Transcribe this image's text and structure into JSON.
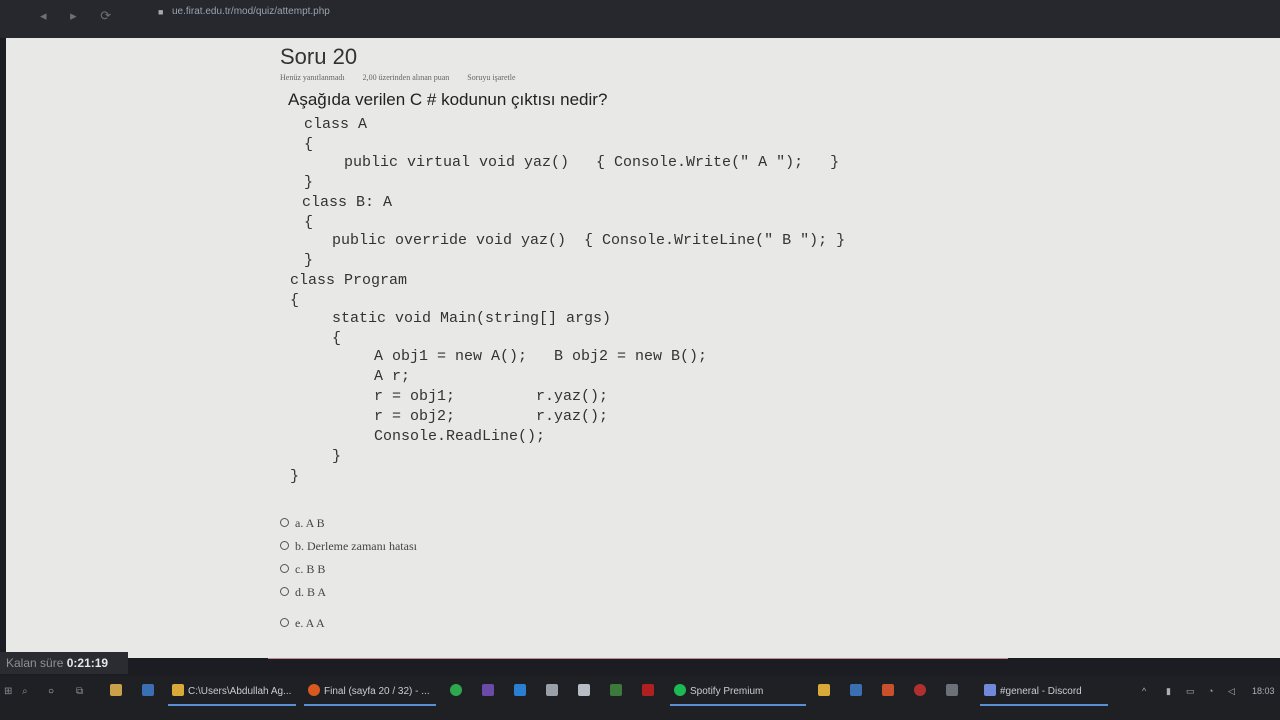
{
  "browser": {
    "url": "ue.firat.edu.tr/mod/quiz/attempt.php"
  },
  "question": {
    "title": "Soru 20",
    "meta": [
      "Henüz yanıtlanmadı",
      "2,00 üzerinden alınan puan",
      "Soruyu işaretle"
    ],
    "text": "Aşağıda verilen C # kodunun çıktısı nedir?",
    "code_lines": [
      "class A",
      "{",
      "public virtual void yaz()   { Console.Write(\" A \");   }",
      "}",
      "class B: A",
      "{",
      "public override void yaz()  { Console.WriteLine(\" B \"); }",
      "}",
      "class Program",
      "{",
      "static void Main(string[] args)",
      "{",
      "A obj1 = new A();   B obj2 = new B();",
      "A r;",
      "r = obj1;         r.yaz();",
      "r = obj2;         r.yaz();",
      "Console.ReadLine();",
      "}",
      "}"
    ],
    "options": [
      "a. A B",
      "b. Derleme zamanı hatası",
      "c. B B",
      "d. B A",
      "e. A A"
    ]
  },
  "timer": {
    "label": "Kalan süre",
    "value": "0:21:19"
  },
  "taskbar": {
    "items": [
      "C:\\Users\\Abdullah  Ag...",
      "Final (sayfa 20 / 32) - ...",
      "Spotify Premium",
      "#general - Discord"
    ],
    "clock": "18:03"
  },
  "colors": {
    "page_bg": "#e8e8e6",
    "taskbar_bg": "#1e2024",
    "divider": "#c98a8a"
  }
}
